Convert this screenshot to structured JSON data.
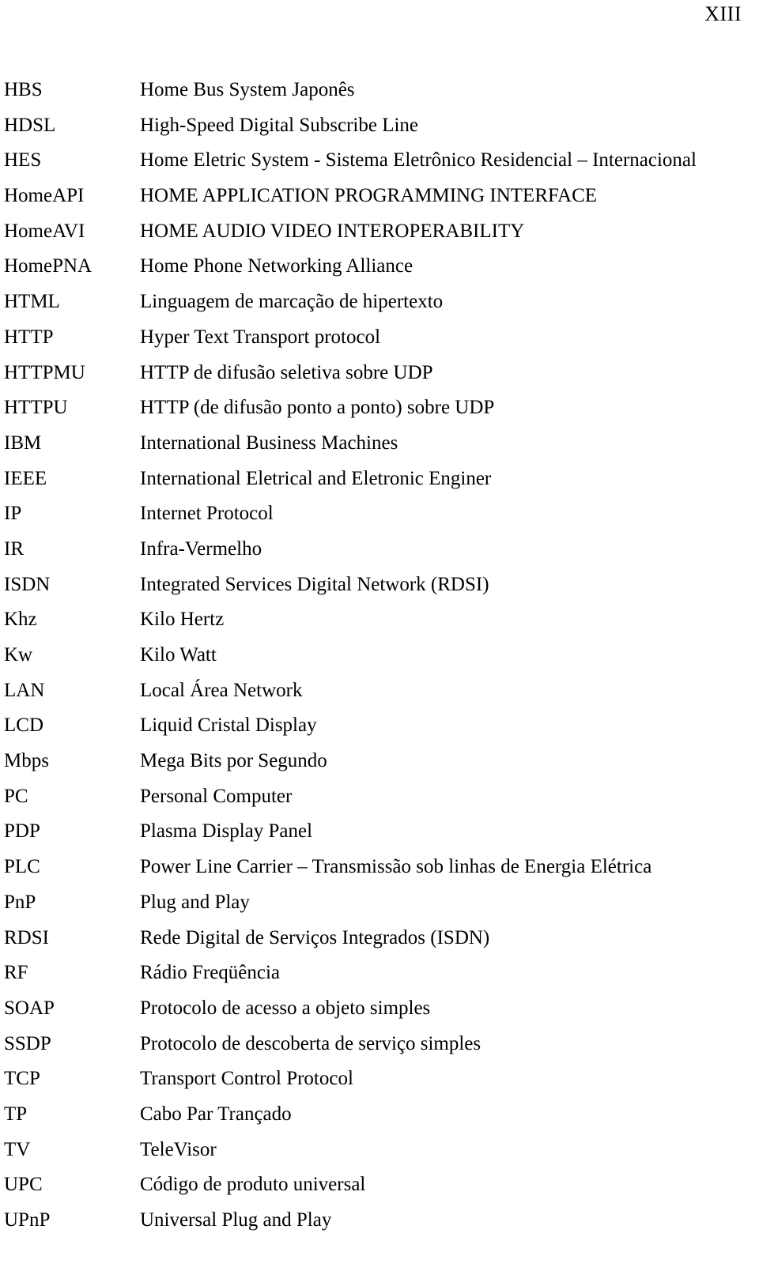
{
  "page": {
    "page_number": "XIII",
    "background_color": "#ffffff",
    "text_color": "#000000"
  },
  "glossary": {
    "entries": [
      {
        "term": "HBS",
        "definition": "Home Bus System Japonês"
      },
      {
        "term": "HDSL",
        "definition": "High-Speed Digital Subscribe Line"
      },
      {
        "term": "HES",
        "definition": "Home Eletric System - Sistema Eletrônico Residencial – Internacional"
      },
      {
        "term": "HomeAPI",
        "definition": "HOME APPLICATION PROGRAMMING INTERFACE"
      },
      {
        "term": "HomeAVI",
        "definition": "HOME AUDIO VIDEO INTEROPERABILITY"
      },
      {
        "term": "HomePNA",
        "definition": "Home Phone Networking Alliance"
      },
      {
        "term": "HTML",
        "definition": "Linguagem de marcação de hipertexto"
      },
      {
        "term": "HTTP",
        "definition": "Hyper Text Transport protocol"
      },
      {
        "term": "HTTPMU",
        "definition": "HTTP de difusão seletiva sobre UDP"
      },
      {
        "term": "HTTPU",
        "definition": "HTTP (de difusão ponto a ponto) sobre UDP"
      },
      {
        "term": "IBM",
        "definition": "International Business Machines"
      },
      {
        "term": "IEEE",
        "definition": "International Eletrical and Eletronic Enginer"
      },
      {
        "term": "IP",
        "definition": "Internet Protocol"
      },
      {
        "term": "IR",
        "definition": "Infra-Vermelho"
      },
      {
        "term": "ISDN",
        "definition": "Integrated Services Digital Network (RDSI)"
      },
      {
        "term": "Khz",
        "definition": "Kilo Hertz"
      },
      {
        "term": "Kw",
        "definition": "Kilo Watt"
      },
      {
        "term": "LAN",
        "definition": "Local Área Network"
      },
      {
        "term": "LCD",
        "definition": "Liquid Cristal Display"
      },
      {
        "term": "Mbps",
        "definition": "Mega Bits por Segundo"
      },
      {
        "term": "PC",
        "definition": "Personal Computer"
      },
      {
        "term": "PDP",
        "definition": "Plasma Display Panel"
      },
      {
        "term": "PLC",
        "definition": "Power Line Carrier – Transmissão sob linhas de Energia Elétrica"
      },
      {
        "term": "PnP",
        "definition": "Plug and Play"
      },
      {
        "term": "RDSI",
        "definition": "Rede Digital de Serviços Integrados (ISDN)"
      },
      {
        "term": "RF",
        "definition": "Rádio Freqüência"
      },
      {
        "term": "SOAP",
        "definition": "Protocolo de acesso a objeto simples"
      },
      {
        "term": "SSDP",
        "definition": "Protocolo de descoberta de serviço simples"
      },
      {
        "term": "TCP",
        "definition": "Transport Control Protocol"
      },
      {
        "term": "TP",
        "definition": "Cabo Par Trançado"
      },
      {
        "term": "TV",
        "definition": "TeleVisor"
      },
      {
        "term": "UPC",
        "definition": "Código de produto universal"
      },
      {
        "term": "UPnP",
        "definition": "Universal Plug and Play"
      }
    ]
  }
}
